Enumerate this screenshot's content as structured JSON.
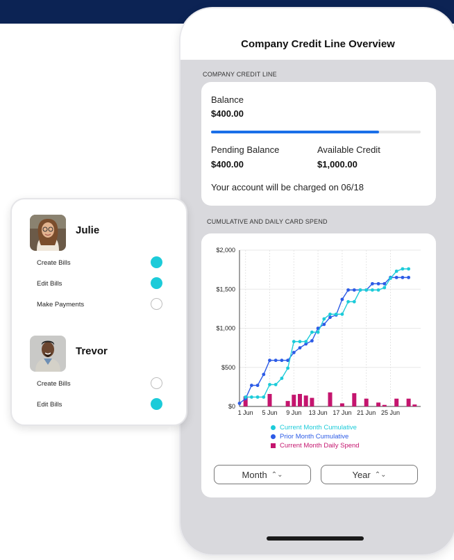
{
  "app": {
    "title": "Company Credit Line Overview"
  },
  "credit_line": {
    "section_label": "COMPANY CREDIT LINE",
    "balance_label": "Balance",
    "balance_value": "$400.00",
    "balance_progress": 0.8,
    "pending_label": "Pending Balance",
    "pending_value": "$400.00",
    "available_label": "Available Credit",
    "available_value": "$1,000.00",
    "charge_note": "Your account will be charged on 06/18"
  },
  "spend": {
    "section_label": "CUMULATIVE AND DAILY CARD SPEND",
    "period_buttons": [
      {
        "label": "Month",
        "icon": "chevron-updown-icon"
      },
      {
        "label": "Year",
        "icon": "chevron-updown-icon"
      }
    ]
  },
  "permissions": {
    "users": [
      {
        "name": "Julie",
        "avatar": "julie-avatar",
        "permissions": [
          {
            "label": "Create Bills",
            "enabled": true
          },
          {
            "label": "Edit Bills",
            "enabled": true
          },
          {
            "label": "Make Payments",
            "enabled": false
          }
        ]
      },
      {
        "name": "Trevor",
        "avatar": "trevor-avatar",
        "permissions": [
          {
            "label": "Create Bills",
            "enabled": false
          },
          {
            "label": "Edit Bills",
            "enabled": true
          }
        ]
      }
    ]
  },
  "colors": {
    "header_navy": "#0c2354",
    "progress_blue": "#1a6fe8",
    "toggle_on": "#1ccbd9",
    "current_cumulative": "#1ccbd9",
    "prior_cumulative": "#2c5be6",
    "daily_spend": "#c4156e"
  },
  "chart_data": {
    "type": "line",
    "title": "",
    "xlabel": "",
    "ylabel": "",
    "ylim": [
      0,
      2000
    ],
    "yticks": [
      "$0",
      "$500",
      "$1,000",
      "$1,500",
      "$2,000"
    ],
    "ytick_values": [
      0,
      500,
      1000,
      1500,
      2000
    ],
    "x_tick_labels": [
      "1 Jun",
      "5 Jun",
      "9 Jun",
      "13 Jun",
      "17 Jun",
      "21 Jun",
      "25 Jun"
    ],
    "x_tick_days": [
      1,
      5,
      9,
      13,
      17,
      21,
      25
    ],
    "grid": true,
    "legend_placement": "bottom",
    "series": [
      {
        "name": "Current Month Cumulative",
        "kind": "line",
        "color": "#1ccbd9",
        "x": [
          1,
          2,
          3,
          4,
          5,
          6,
          7,
          8,
          9,
          10,
          11,
          12,
          13,
          14,
          15,
          16,
          17,
          18,
          19,
          20,
          21,
          22,
          23,
          24,
          25,
          26,
          27,
          28
        ],
        "values": [
          120,
          120,
          120,
          120,
          280,
          280,
          360,
          490,
          830,
          830,
          830,
          950,
          950,
          1120,
          1180,
          1180,
          1180,
          1340,
          1340,
          1490,
          1490,
          1490,
          1490,
          1520,
          1640,
          1730,
          1760,
          1760
        ]
      },
      {
        "name": "Prior Month Cumulative",
        "kind": "line",
        "color": "#2c5be6",
        "x": [
          0,
          1,
          2,
          3,
          4,
          5,
          6,
          7,
          8,
          9,
          10,
          11,
          12,
          13,
          14,
          15,
          16,
          17,
          18,
          19,
          20,
          21,
          22,
          23,
          24,
          25,
          26,
          27,
          28
        ],
        "values": [
          40,
          100,
          270,
          270,
          410,
          590,
          590,
          590,
          590,
          690,
          750,
          800,
          840,
          1000,
          1050,
          1140,
          1170,
          1370,
          1490,
          1490,
          1490,
          1490,
          1570,
          1570,
          1570,
          1650,
          1650,
          1650,
          1650
        ]
      },
      {
        "name": "Current Month Daily Spend",
        "kind": "bar",
        "color": "#c4156e",
        "x": [
          1,
          5,
          8,
          9,
          10,
          11,
          12,
          15,
          17,
          19,
          21,
          23,
          24,
          26,
          28,
          29,
          30
        ],
        "values": [
          130,
          160,
          70,
          150,
          160,
          140,
          110,
          180,
          40,
          170,
          100,
          50,
          20,
          100,
          100,
          25,
          0
        ]
      }
    ]
  }
}
